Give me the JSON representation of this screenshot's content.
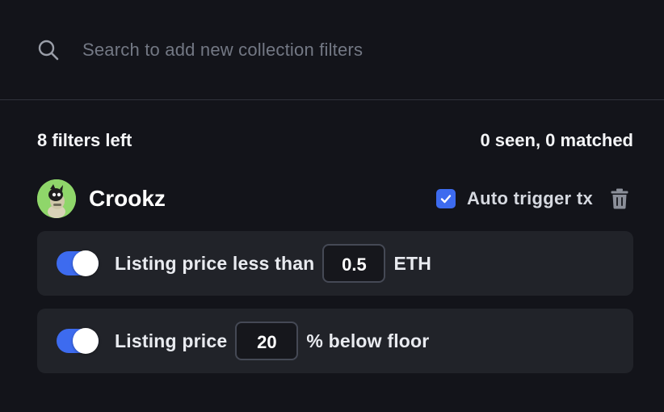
{
  "search": {
    "placeholder": "Search to add new collection filters",
    "value": ""
  },
  "status": {
    "filters_left": "8 filters left",
    "seen_matched": "0 seen, 0 matched"
  },
  "collection": {
    "name": "Crookz",
    "auto_trigger_label": "Auto trigger tx",
    "auto_trigger_checked": true
  },
  "filters": [
    {
      "enabled": true,
      "prefix": "Listing price less than",
      "value": "0.5",
      "suffix": "ETH"
    },
    {
      "enabled": true,
      "prefix": "Listing price",
      "value": "20",
      "suffix": "% below floor"
    }
  ],
  "colors": {
    "background": "#13141a",
    "card": "#212329",
    "accent": "#3d6bef",
    "avatar_bg": "#8fd66a"
  },
  "icons": {
    "search": "search-icon",
    "checkbox": "check-icon",
    "delete": "trash-icon",
    "avatar": "collection-avatar"
  }
}
